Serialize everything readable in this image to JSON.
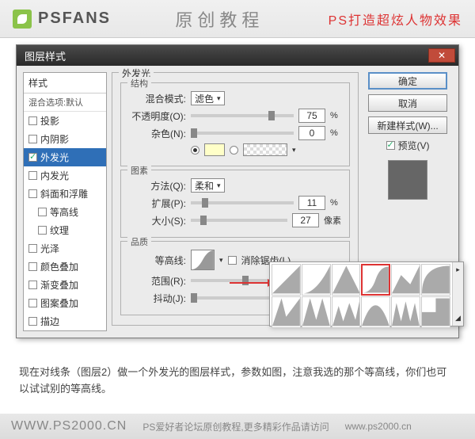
{
  "banner": {
    "logo": "PSFANS",
    "center": "原创教程",
    "right": "PS打造超炫人物效果"
  },
  "dialog": {
    "title": "图层样式",
    "styles_header": "样式",
    "blend_default": "混合选项:默认",
    "style_list": [
      {
        "label": "投影",
        "checked": false,
        "indent": false
      },
      {
        "label": "内阴影",
        "checked": false,
        "indent": false
      },
      {
        "label": "外发光",
        "checked": true,
        "indent": false,
        "active": true
      },
      {
        "label": "内发光",
        "checked": false,
        "indent": false
      },
      {
        "label": "斜面和浮雕",
        "checked": false,
        "indent": false
      },
      {
        "label": "等高线",
        "checked": false,
        "indent": true
      },
      {
        "label": "纹理",
        "checked": false,
        "indent": true
      },
      {
        "label": "光泽",
        "checked": false,
        "indent": false
      },
      {
        "label": "颜色叠加",
        "checked": false,
        "indent": false
      },
      {
        "label": "渐变叠加",
        "checked": false,
        "indent": false
      },
      {
        "label": "图案叠加",
        "checked": false,
        "indent": false
      },
      {
        "label": "描边",
        "checked": false,
        "indent": false
      }
    ],
    "section_title": "外发光",
    "structure_label": "结构",
    "blend_mode_label": "混合模式:",
    "blend_mode_value": "滤色",
    "opacity_label": "不透明度(O):",
    "opacity_value": "75",
    "noise_label": "杂色(N):",
    "noise_value": "0",
    "elements_label": "图素",
    "technique_label": "方法(Q):",
    "technique_value": "柔和",
    "spread_label": "扩展(P):",
    "spread_value": "11",
    "size_label": "大小(S):",
    "size_value": "27",
    "size_unit": "像素",
    "quality_label": "品质",
    "contour_label": "等高线:",
    "antialias_label": "消除锯齿(L)",
    "range_label": "范围(R):",
    "range_value": "50",
    "jitter_label": "抖动(J):",
    "jitter_value": "0",
    "percent": "%",
    "buttons": {
      "ok": "确定",
      "cancel": "取消",
      "new_style": "新建样式(W)..."
    },
    "preview_label": "预览(V)"
  },
  "caption": "现在对线条（图层2）做一个外发光的图层样式，参数如图，注意我选的那个等高线，你们也可以试试别的等高线。",
  "footer": {
    "url": "WWW.PS2000.CN",
    "text": "PS爱好者论坛原创教程,更多精彩作品请访问",
    "text2": "www.ps2000.cn"
  }
}
